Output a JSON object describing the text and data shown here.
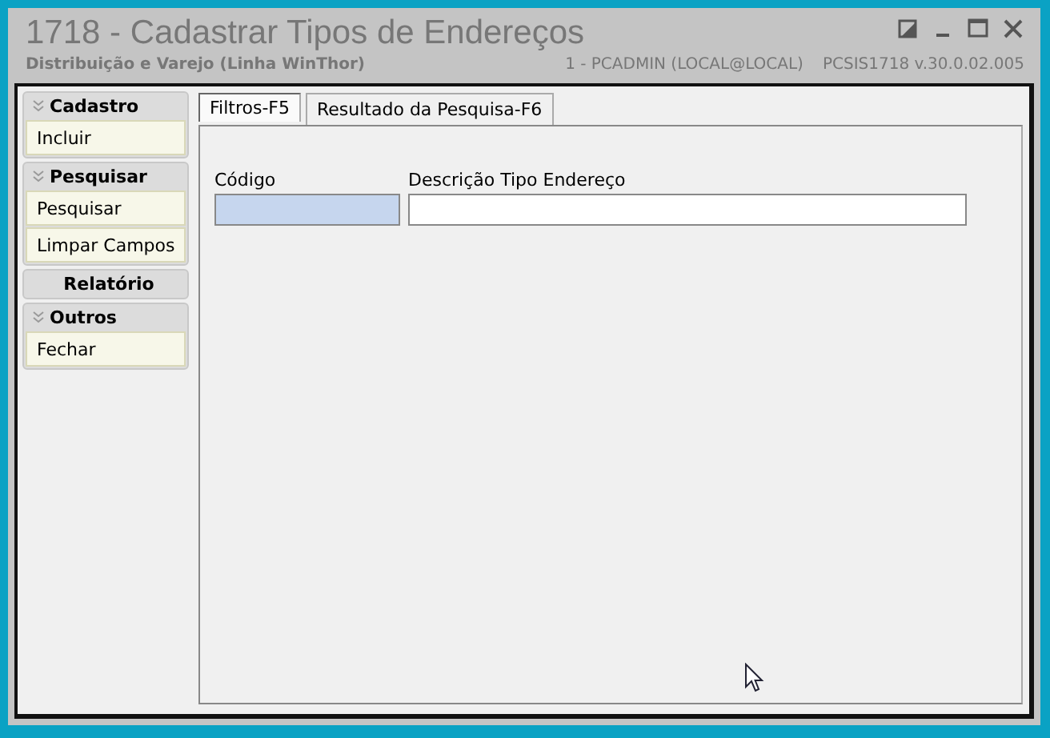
{
  "window": {
    "title": "1718 - Cadastrar Tipos de Endereços",
    "subtitle": "Distribuição e Varejo (Linha WinThor)",
    "user": "1 - PCADMIN (LOCAL@LOCAL)",
    "version": "PCSIS1718  v.30.0.02.005"
  },
  "sidebar": {
    "sections": [
      {
        "title": "Cadastro",
        "expanded": true,
        "items": [
          "Incluir"
        ]
      },
      {
        "title": "Pesquisar",
        "expanded": true,
        "items": [
          "Pesquisar",
          "Limpar Campos"
        ]
      },
      {
        "title": "Relatório",
        "expanded": false
      },
      {
        "title": "Outros",
        "expanded": true,
        "items": [
          "Fechar"
        ]
      }
    ]
  },
  "tabs": [
    {
      "label": "Filtros-F5",
      "selected": true
    },
    {
      "label": "Resultado da Pesquisa-F6",
      "selected": false
    }
  ],
  "fields": [
    {
      "label": "Código",
      "focused": true
    },
    {
      "label": "Descrição Tipo Endereço",
      "focused": false
    }
  ]
}
